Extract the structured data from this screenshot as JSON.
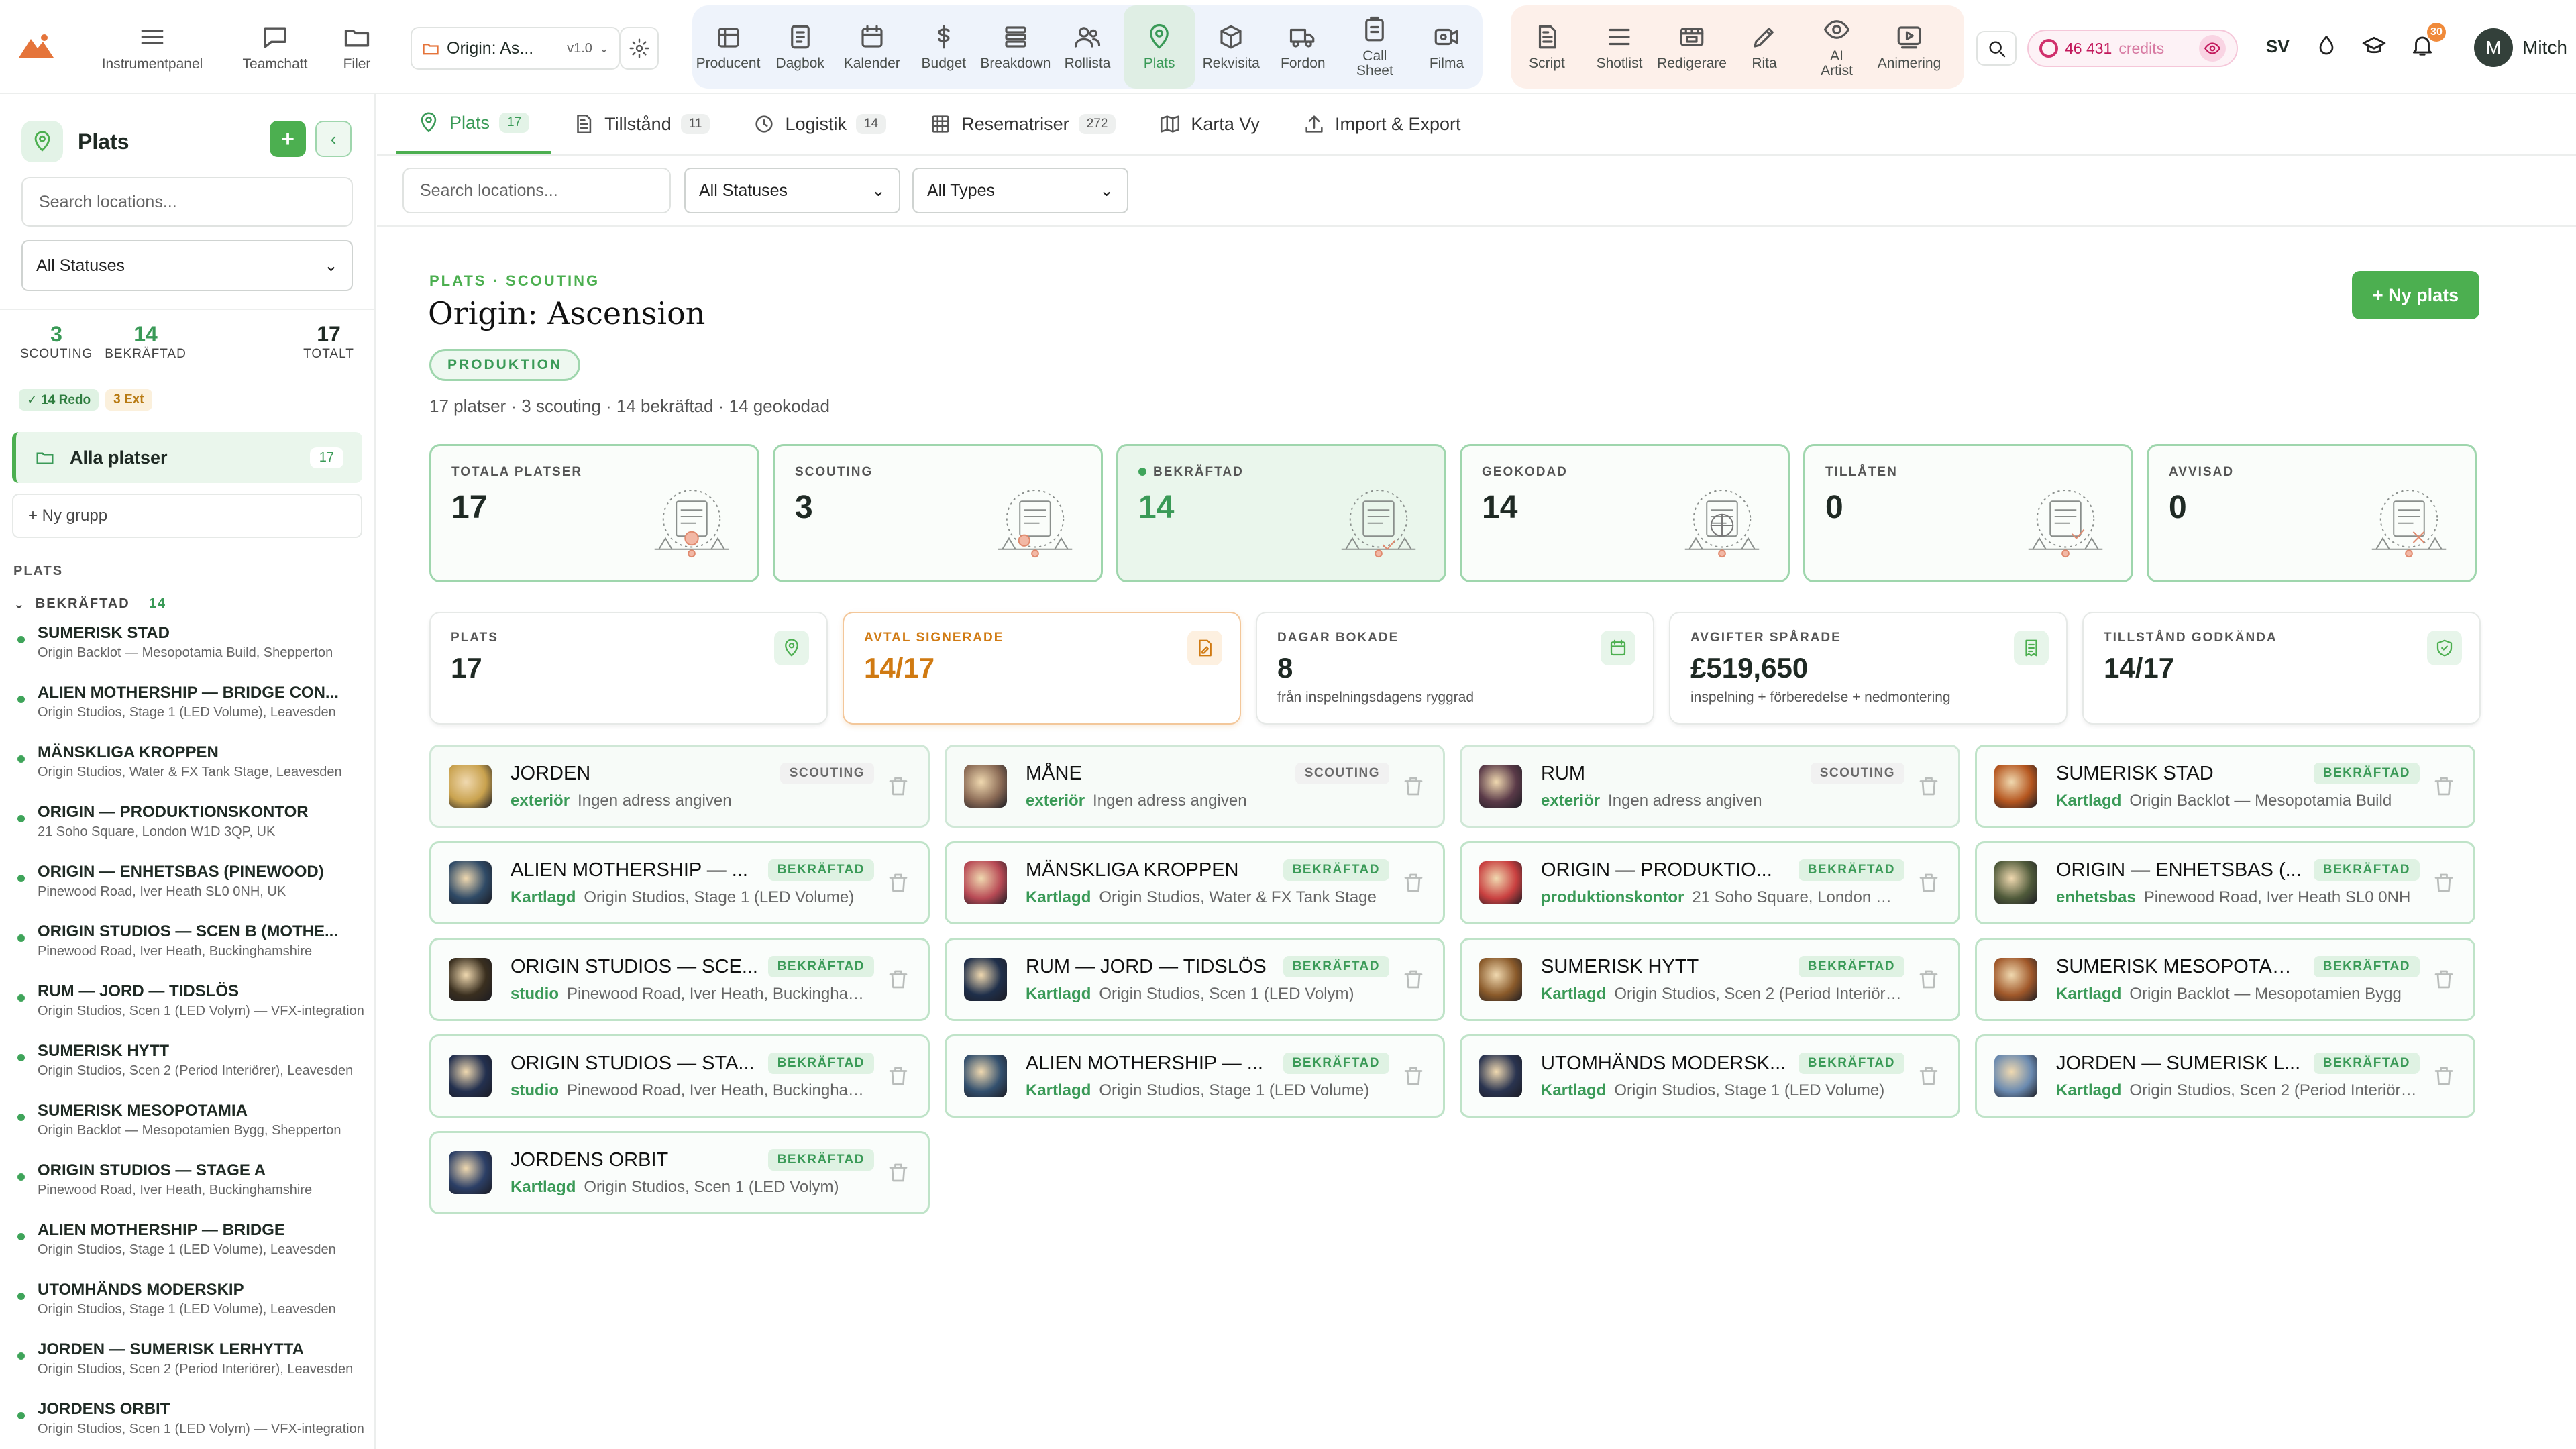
{
  "topbar": {
    "left": [
      {
        "label": "Instrumentpanel",
        "icon": "menu-icon"
      },
      {
        "label": "Teamchatt",
        "icon": "chat-icon"
      },
      {
        "label": "Filer",
        "icon": "folder-icon"
      }
    ],
    "project": {
      "name": "Origin: As...",
      "version": "v1.0"
    },
    "modules": [
      {
        "label": "Producent",
        "icon": "calendar-grid-icon"
      },
      {
        "label": "Dagbok",
        "icon": "notebook-icon"
      },
      {
        "label": "Kalender",
        "icon": "calendar-icon"
      },
      {
        "label": "Budget",
        "icon": "dollar-icon"
      },
      {
        "label": "Breakdown",
        "icon": "layers-icon"
      },
      {
        "label": "Rollista",
        "icon": "users-icon"
      },
      {
        "label": "Plats",
        "icon": "map-pin-icon",
        "active": true
      },
      {
        "label": "Rekvisita",
        "icon": "box-icon"
      },
      {
        "label": "Fordon",
        "icon": "truck-icon"
      },
      {
        "label": "Call\nSheet",
        "icon": "clipboard-icon"
      },
      {
        "label": "Filma",
        "icon": "video-icon"
      }
    ],
    "creative": [
      {
        "label": "Script",
        "icon": "document-icon"
      },
      {
        "label": "Shotlist",
        "icon": "list-icon"
      },
      {
        "label": "Redigerare",
        "icon": "film-icon"
      },
      {
        "label": "Rita",
        "icon": "pen-icon"
      },
      {
        "label": "AI\nArtist",
        "icon": "eye-icon"
      },
      {
        "label": "Animering",
        "icon": "play-icon"
      }
    ],
    "credits": {
      "amount": "46 431",
      "label": "credits"
    },
    "lang": "SV",
    "notifications": "30",
    "user": {
      "initial": "M",
      "name": "Mitch"
    }
  },
  "sidebar": {
    "title": "Plats",
    "search_placeholder": "Search locations...",
    "status_select": "All Statuses",
    "stats": [
      {
        "value": "3",
        "label": "SCOUTING"
      },
      {
        "value": "14",
        "label": "BEKRÄFTAD"
      },
      {
        "value": "17",
        "label": "TOTALT"
      }
    ],
    "badges": {
      "ready": "✓ 14 Redo",
      "ext": "3 Ext"
    },
    "all_label": "Alla platser",
    "all_count": "17",
    "new_group": "+  Ny grupp",
    "section": "PLATS",
    "group": {
      "label": "BEKRÄFTAD",
      "count": "14"
    },
    "items": [
      {
        "name": "SUMERISK STAD",
        "sub": "Origin Backlot — Mesopotamia Build, Shepperton"
      },
      {
        "name": "ALIEN MOTHERSHIP — BRIDGE CON...",
        "sub": "Origin Studios, Stage 1 (LED Volume), Leavesden"
      },
      {
        "name": "MÄNSKLIGA KROPPEN",
        "sub": "Origin Studios, Water & FX Tank Stage, Leavesden"
      },
      {
        "name": "ORIGIN — PRODUKTIONSKONTOR",
        "sub": "21 Soho Square, London W1D 3QP, UK"
      },
      {
        "name": "ORIGIN — ENHETSBAS (PINEWOOD)",
        "sub": "Pinewood Road, Iver Heath SL0 0NH, UK"
      },
      {
        "name": "ORIGIN STUDIOS — SCEN B (MOTHE...",
        "sub": "Pinewood Road, Iver Heath, Buckinghamshire"
      },
      {
        "name": "RUM — JORD — TIDSLÖS",
        "sub": "Origin Studios, Scen 1 (LED Volym) — VFX-integration"
      },
      {
        "name": "SUMERISK HYTT",
        "sub": "Origin Studios, Scen 2 (Period Interiörer), Leavesden"
      },
      {
        "name": "SUMERISK MESOPOTAMIA",
        "sub": "Origin Backlot — Mesopotamien Bygg, Shepperton"
      },
      {
        "name": "ORIGIN STUDIOS — STAGE A",
        "sub": "Pinewood Road, Iver Heath, Buckinghamshire"
      },
      {
        "name": "ALIEN MOTHERSHIP — BRIDGE",
        "sub": "Origin Studios, Stage 1 (LED Volume), Leavesden"
      },
      {
        "name": "UTOMHÄNDS MODERSKIP",
        "sub": "Origin Studios, Stage 1 (LED Volume), Leavesden"
      },
      {
        "name": "JORDEN — SUMERISK LERHYTTA",
        "sub": "Origin Studios, Scen 2 (Period Interiörer), Leavesden"
      },
      {
        "name": "JORDENS ORBIT",
        "sub": "Origin Studios, Scen 1 (LED Volym) — VFX-integration"
      }
    ]
  },
  "tabs": [
    {
      "label": "Plats",
      "count": "17",
      "icon": "map-pin-icon",
      "active": true
    },
    {
      "label": "Tillstånd",
      "count": "11",
      "icon": "document-icon"
    },
    {
      "label": "Logistik",
      "count": "14",
      "icon": "clock-icon"
    },
    {
      "label": "Resematriser",
      "count": "272",
      "icon": "grid-icon"
    },
    {
      "label": "Karta Vy",
      "icon": "map-icon"
    },
    {
      "label": "Import & Export",
      "icon": "upload-icon"
    }
  ],
  "filters": {
    "search_placeholder": "Search locations...",
    "status": "All Statuses",
    "type": "All Types"
  },
  "header": {
    "breadcrumb": "PLATS · SCOUTING",
    "title": "Origin: Ascension",
    "phase": "PRODUKTION",
    "summary": "17 platser · 3 scouting · 14 bekräftad · 14 geokodad",
    "new_button": "+ Ny plats"
  },
  "kpis": [
    {
      "label": "TOTALA PLATSER",
      "value": "17"
    },
    {
      "label": "SCOUTING",
      "value": "3"
    },
    {
      "label": "BEKRÄFTAD",
      "value": "14",
      "highlight": true
    },
    {
      "label": "GEOKODAD",
      "value": "14"
    },
    {
      "label": "TILLÅTEN",
      "value": "0"
    },
    {
      "label": "AVVISAD",
      "value": "0"
    }
  ],
  "kpis2": [
    {
      "label": "PLATS",
      "value": "17",
      "sub": "",
      "icon": "map-pin-icon"
    },
    {
      "label": "AVTAL SIGNERADE",
      "value": "14/17",
      "sub": "",
      "icon": "edit-doc-icon",
      "accent": "#d07a12"
    },
    {
      "label": "DAGAR BOKADE",
      "value": "8",
      "sub": "från inspelningsdagens ryggrad",
      "icon": "calendar-icon"
    },
    {
      "label": "AVGIFTER SPÅRADE",
      "value": "£519,650",
      "sub": "inspelning + förberedelse + nedmontering",
      "icon": "receipt-icon"
    },
    {
      "label": "TILLSTÅND GODKÄNDA",
      "value": "14/17",
      "sub": "",
      "icon": "shield-icon"
    }
  ],
  "colors": {
    "accent": "#4caf50",
    "accent_dark": "#3a9a57",
    "orange": "#d07a12",
    "pink": "#c2185b"
  },
  "locations": [
    {
      "name": "JORDEN",
      "status": "SCOUTING",
      "type": "exteriör",
      "addr": "Ingen adress angiven",
      "thumb": "#c9a24e"
    },
    {
      "name": "MÅNE",
      "status": "SCOUTING",
      "type": "exteriör",
      "addr": "Ingen adress angiven",
      "thumb": "#8a6a55"
    },
    {
      "name": "RUM",
      "status": "SCOUTING",
      "type": "exteriör",
      "addr": "Ingen adress angiven",
      "thumb": "#5a3a48"
    },
    {
      "name": "SUMERISK STAD",
      "status": "BEKRÄFTAD",
      "type": "Kartlagd",
      "addr": "Origin Backlot — Mesopotamia Build",
      "thumb": "#b5561f"
    },
    {
      "name": "ALIEN MOTHERSHIP — ...",
      "status": "BEKRÄFTAD",
      "type": "Kartlagd",
      "addr": "Origin Studios, Stage 1 (LED Volume)",
      "thumb": "#2f4a66"
    },
    {
      "name": "MÄNSKLIGA KROPPEN",
      "status": "BEKRÄFTAD",
      "type": "Kartlagd",
      "addr": "Origin Studios, Water & FX Tank Stage",
      "thumb": "#b84a55"
    },
    {
      "name": "ORIGIN — PRODUKTIO...",
      "status": "BEKRÄFTAD",
      "type": "produktionskontor",
      "addr": "21 Soho Square, London W1D 3QP",
      "thumb": "#c94040"
    },
    {
      "name": "ORIGIN — ENHETSBAS (...",
      "status": "BEKRÄFTAD",
      "type": "enhetsbas",
      "addr": "Pinewood Road, Iver Heath SL0 0NH",
      "thumb": "#4f5a3a"
    },
    {
      "name": "ORIGIN STUDIOS — SCE...",
      "status": "BEKRÄFTAD",
      "type": "studio",
      "addr": "Pinewood Road, Iver Heath, Buckinghamshire",
      "thumb": "#3a2f1f"
    },
    {
      "name": "RUM — JORD — TIDSLÖS",
      "status": "BEKRÄFTAD",
      "type": "Kartlagd",
      "addr": "Origin Studios, Scen 1 (LED Volym)",
      "thumb": "#1f2f4a"
    },
    {
      "name": "SUMERISK HYTT",
      "status": "BEKRÄFTAD",
      "type": "Kartlagd",
      "addr": "Origin Studios, Scen 2 (Period Interiörer)",
      "thumb": "#8a5a2a"
    },
    {
      "name": "SUMERISK MESOPOTAM...",
      "status": "BEKRÄFTAD",
      "type": "Kartlagd",
      "addr": "Origin Backlot — Mesopotamien Bygg",
      "thumb": "#a0582a"
    },
    {
      "name": "ORIGIN STUDIOS — STA...",
      "status": "BEKRÄFTAD",
      "type": "studio",
      "addr": "Pinewood Road, Iver Heath, Buckinghamshire",
      "thumb": "#23304f"
    },
    {
      "name": "ALIEN MOTHERSHIP — ...",
      "status": "BEKRÄFTAD",
      "type": "Kartlagd",
      "addr": "Origin Studios, Stage 1 (LED Volume)",
      "thumb": "#33506e"
    },
    {
      "name": "UTOMHÄNDS MODERSK...",
      "status": "BEKRÄFTAD",
      "type": "Kartlagd",
      "addr": "Origin Studios, Stage 1 (LED Volume)",
      "thumb": "#2a3450"
    },
    {
      "name": "JORDEN — SUMERISK L...",
      "status": "BEKRÄFTAD",
      "type": "Kartlagd",
      "addr": "Origin Studios, Scen 2 (Period Interiörer)",
      "thumb": "#6a8ab0"
    },
    {
      "name": "JORDENS ORBIT",
      "status": "BEKRÄFTAD",
      "type": "Kartlagd",
      "addr": "Origin Studios, Scen 1 (LED Volym)",
      "thumb": "#2c3f66"
    }
  ]
}
